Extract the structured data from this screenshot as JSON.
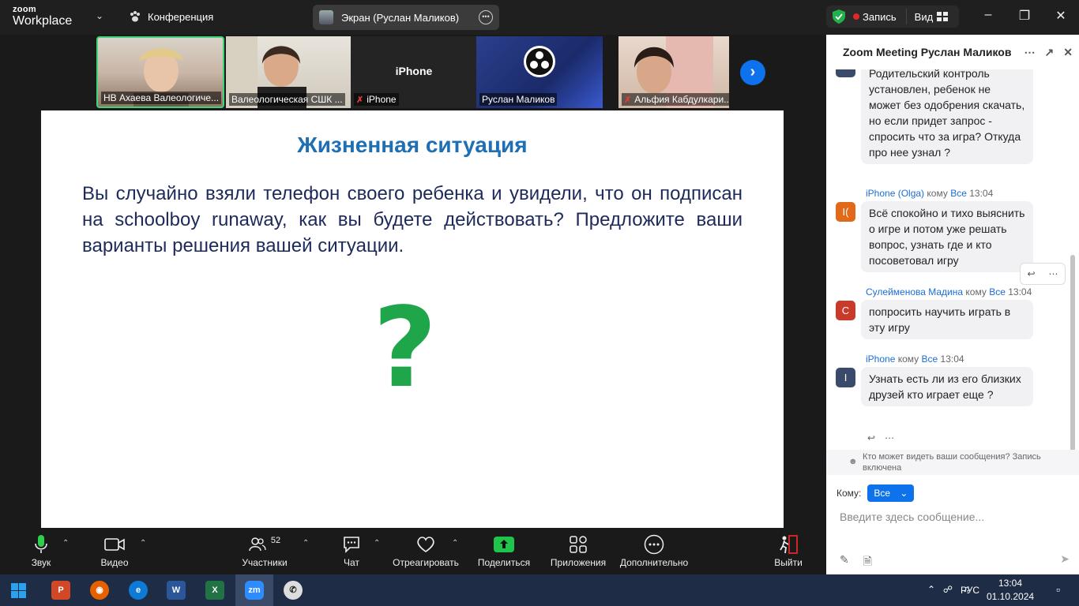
{
  "app": {
    "logo_top": "zoom",
    "logo_bottom": "Workplace",
    "conference": "Конференция",
    "screen_share": "Экран (Руслан Маликов)",
    "record": "Запись",
    "view": "Вид"
  },
  "thumbnails": [
    {
      "name": "НВ Ахаева Валеологиче..."
    },
    {
      "name": "Валеологическая СШК ..."
    },
    {
      "name": "iPhone",
      "big": "iPhone"
    },
    {
      "name": "Руслан Маликов"
    },
    {
      "name": "Альфия Кабдулкари..."
    }
  ],
  "slide": {
    "title": "Жизненная ситуация",
    "text": "Вы случайно взяли телефон своего ребенка и увидели, что он подписан на schoolboy runaway, как вы будете действовать? Предложите ваши варианты решения вашей ситуации.",
    "qmark": "?"
  },
  "toolbar": {
    "audio": "Звук",
    "video": "Видео",
    "participants": "Участники",
    "participants_count": "52",
    "chat": "Чат",
    "react": "Отреагировать",
    "share": "Поделиться",
    "apps": "Приложения",
    "more": "Дополнительно",
    "leave": "Выйти"
  },
  "chat": {
    "title": "Zoom Meeting Руслан Маликов",
    "messages": [
      {
        "text": "Родительский контроль установлен, ребенок не может без одобрения скачать, но если придет запрос - спросить что за игра? Откуда про нее узнал ?"
      },
      {
        "sender": "iPhone (Olga)",
        "to_word": "кому",
        "to": "Все",
        "time": "13:04",
        "avatar": "I(",
        "text": "Всё спокойно и тихо выяснить о игре и потом уже решать вопрос, узнать где и кто посоветовал игру"
      },
      {
        "sender": "Сулейменова Мадина",
        "to_word": "кому",
        "to": "Все",
        "time": "13:04",
        "avatar": "С",
        "text": "попросить научить играть в эту игру"
      },
      {
        "sender": "iPhone",
        "to_word": "кому",
        "to": "Все",
        "time": "13:04",
        "avatar": "I",
        "text": "Узнать есть ли из его близких друзей кто играет еще ?"
      }
    ],
    "who_sees": "Кто может видеть ваши сообщения? Запись включена",
    "to_label": "Кому:",
    "to_value": "Все",
    "placeholder": "Введите здесь сообщение..."
  },
  "taskbar": {
    "lang": "РУС",
    "time": "13:04",
    "date": "01.10.2024"
  }
}
